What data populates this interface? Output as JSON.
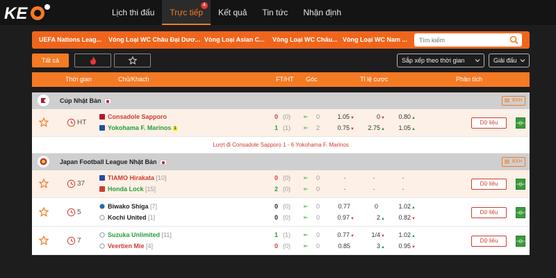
{
  "nav": {
    "logo_text": "KEO",
    "items": [
      {
        "label": "Lịch thi đấu",
        "active": false
      },
      {
        "label": "Trực tiếp",
        "active": true,
        "badge": "4"
      },
      {
        "label": "Kết quả",
        "active": false
      },
      {
        "label": "Tin tức",
        "active": false
      },
      {
        "label": "Nhận định",
        "active": false
      }
    ]
  },
  "leagues": [
    "UEFA Nations Leag...",
    "Vòng Loại WC Châu Đại Dươ...",
    "Vòng Loại Asian C...",
    "Vòng Loại WC Châu...",
    "Vòng Loại WC Nam ..."
  ],
  "search": {
    "placeholder": "Tìm kiếm"
  },
  "filters": {
    "all_label": "Tất cả",
    "hot_icon": "fire-icon",
    "fav_icon": "star-outline-icon"
  },
  "sort": {
    "label": "Sắp xếp theo thời gian"
  },
  "league_filter": {
    "label": "Giải đấu"
  },
  "columns": {
    "time": "Thời gian",
    "teams": "Chủ/Khách",
    "ftht": "FT/HT",
    "corner": "Góc",
    "odds": "Tỉ lệ cược",
    "analysis": "Phân tích"
  },
  "groups": [
    {
      "name": "Cúp Nhật Bản",
      "bxh": "BXH"
    },
    {
      "name": "Japan Football League Nhật Bản",
      "bxh": "BXH"
    }
  ],
  "first_leg_note": "Lượt đi Consadole Sapporo 1 - 6 Yokohama F. Marinos",
  "matches": [
    {
      "time": "HT",
      "home": {
        "name": "Consadole Sapporo",
        "rank": "",
        "score": "0",
        "ht": "(0)",
        "corner": "0"
      },
      "away": {
        "name": "Yokohama F. Marinos",
        "rank": "",
        "card": "1",
        "score": "1",
        "ht": "(1)",
        "corner": "2"
      },
      "odds": {
        "h1": "1.05",
        "h2": "0",
        "h3": "0.80",
        "a1": "0.75",
        "a2": "2.75",
        "a3": "1.05"
      },
      "data_label": "Dữ liệu"
    },
    {
      "time": "37",
      "home": {
        "name": "TIAMO Hirakata",
        "rank": "[10]",
        "score": "0",
        "ht": "(0)",
        "corner": "0"
      },
      "away": {
        "name": "Honda Lock",
        "rank": "[15]",
        "score": "2",
        "ht": "(0)",
        "corner": "0"
      },
      "odds": {
        "h1": "-",
        "h2": "-",
        "h3": "-",
        "a1": "-",
        "a2": "-",
        "a3": "-"
      },
      "data_label": "Dữ liệu"
    },
    {
      "time": "5",
      "home": {
        "name": "Biwako Shiga",
        "rank": "[7]",
        "score": "0",
        "ht": "(0)",
        "corner": "0"
      },
      "away": {
        "name": "Kochi United",
        "rank": "[1]",
        "score": "0",
        "ht": "(0)",
        "corner": "0"
      },
      "odds": {
        "h1": "0.77",
        "h2": "0",
        "h3": "1.02",
        "a1": "0.97",
        "a2": "2",
        "a3": "0.82"
      },
      "data_label": "Dữ liệu"
    },
    {
      "time": "7",
      "home": {
        "name": "Suzuka Unlimited",
        "rank": "[11]",
        "score": "1",
        "ht": "(1)",
        "corner": "0"
      },
      "away": {
        "name": "Veertien Mie",
        "rank": "[4]",
        "score": "0",
        "ht": "(0)",
        "corner": "0"
      },
      "odds": {
        "h1": "0.77",
        "h2": "1/4",
        "h3": "1.02",
        "a1": "0.85",
        "a2": "3",
        "a3": "0.95"
      },
      "data_label": "Dữ liệu"
    }
  ],
  "colors": {
    "accent": "#f47a24",
    "league_bar": "#f0651c",
    "home_live": "#d13b2f",
    "away_live": "#2a9d3a"
  }
}
